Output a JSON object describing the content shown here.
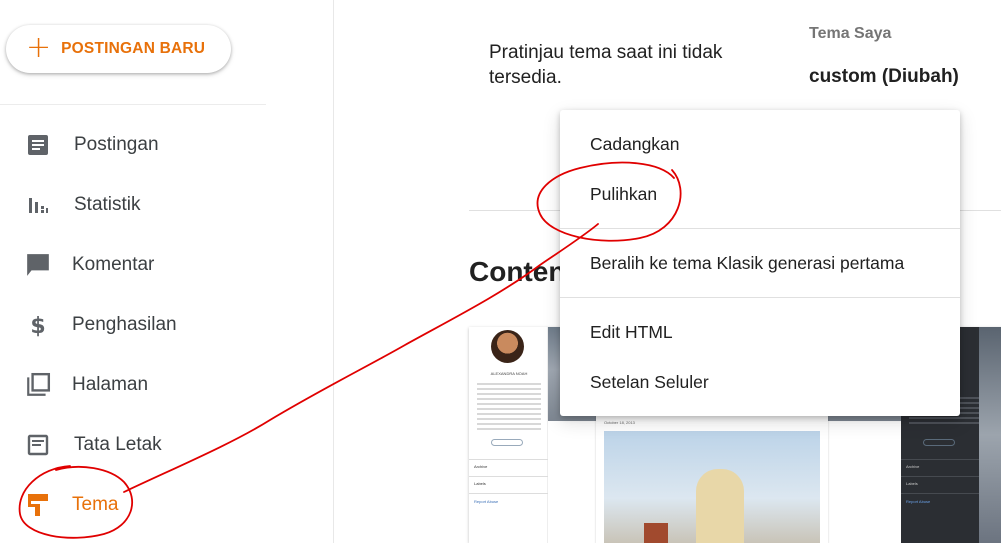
{
  "sidebar": {
    "new_post_label": "POSTINGAN BARU",
    "items": [
      {
        "label": "Postingan",
        "icon": "posts-icon"
      },
      {
        "label": "Statistik",
        "icon": "stats-icon"
      },
      {
        "label": "Komentar",
        "icon": "comment-icon"
      },
      {
        "label": "Penghasilan",
        "icon": "dollar-icon"
      },
      {
        "label": "Halaman",
        "icon": "pages-icon"
      },
      {
        "label": "Tata Letak",
        "icon": "layout-icon"
      },
      {
        "label": "Tema",
        "icon": "theme-paint-roller-icon",
        "active": true
      }
    ]
  },
  "main": {
    "preview_unavailable": "Pratinjau tema saat ini tidak tersedia.",
    "my_theme_label": "Tema Saya",
    "my_theme_name": "custom (Diubah)",
    "section_title": "Conten"
  },
  "thumbnails": {
    "name_small": "ALEXANDRA NOAH",
    "tag_archive": "Archive",
    "tag_labels": "Labels",
    "report_abuse": "Report Abuse",
    "post_date": "October 18, 2013"
  },
  "menu": {
    "items": [
      "Cadangkan",
      "Pulihkan",
      "Beralih ke tema Klasik generasi pertama",
      "Edit HTML",
      "Setelan Seluler"
    ]
  },
  "colors": {
    "accent": "#e8710a",
    "icon_gray": "#5f6368",
    "annotation_red": "#e00000"
  }
}
